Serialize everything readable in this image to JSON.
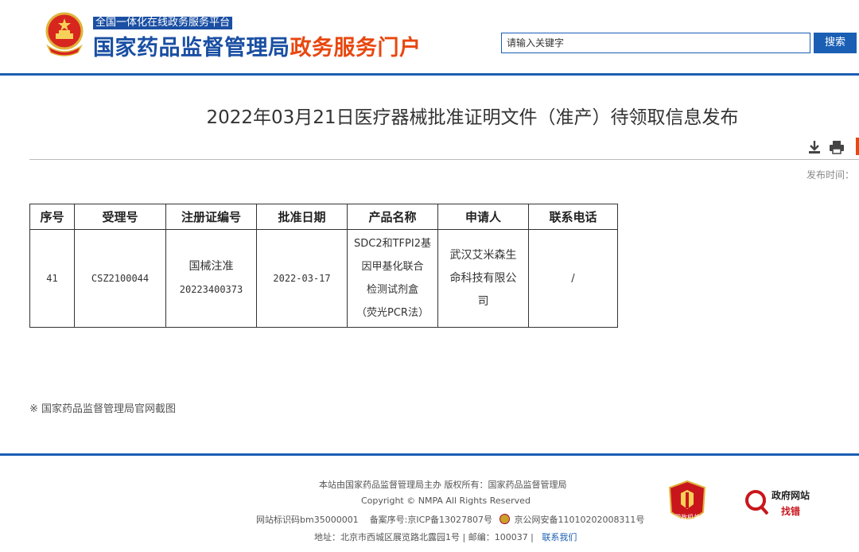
{
  "header": {
    "platform_tag": "全国一体化在线政务服务平台",
    "site_name": "国家药品监督管理局",
    "site_suffix": "政务服务门户",
    "search_placeholder": "请输入关键字",
    "search_button": "搜索"
  },
  "article": {
    "title": "2022年03月21日医疗器械批准证明文件（准产）待领取信息发布",
    "publish_label": "发布时间："
  },
  "table": {
    "headers": [
      "序号",
      "受理号",
      "注册证编号",
      "批准日期",
      "产品名称",
      "申请人",
      "联系电话"
    ],
    "rows": [
      {
        "seq": "41",
        "accept_no": "CSZ2100044",
        "reg_no_l1": "国械注准",
        "reg_no_l2": "20223400373",
        "date": "2022-03-17",
        "product_l1": "SDC2和TFPI2基",
        "product_l2": "因甲基化联合",
        "product_l3": "检测试剂盒",
        "product_l4": "（荧光PCR法）",
        "applicant_l1": "武汉艾米森生",
        "applicant_l2": "命科技有限公",
        "applicant_l3": "司",
        "phone": "/"
      }
    ]
  },
  "note": "※ 国家药品监督管理局官网截图",
  "footer": {
    "line1": "本站由国家药品监督管理局主办 版权所有：国家药品监督管理局",
    "line2": "Copyright © NMPA All Rights Reserved",
    "line3_id": "网站标识码bm35000001",
    "line3_icp": "备案序号:京ICP备13027807号",
    "line3_police": "京公网安备11010202008311号",
    "line4_addr": "地址：北京市西城区展览路北露园1号 | 邮编：100037 |",
    "line4_contact": "联系我们",
    "party_badge_text": "党政机关",
    "gov_line1": "政府网站",
    "gov_line2": "找错"
  },
  "colors": {
    "brand_blue": "#1a4fa3",
    "accent_orange": "#e8470f",
    "rule_blue": "#1a5fb4"
  }
}
